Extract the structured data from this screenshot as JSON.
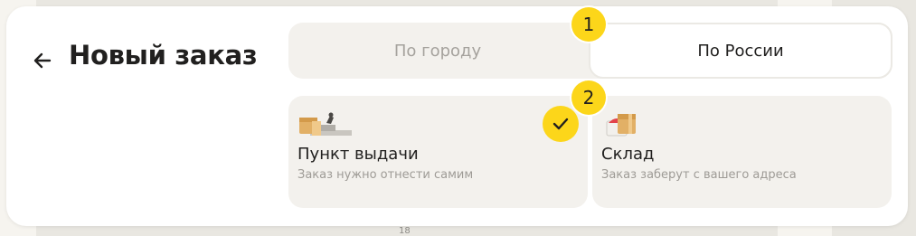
{
  "header": {
    "title": "Новый заказ"
  },
  "tabs": {
    "city_label": "По городу",
    "russia_label": "По России",
    "active": "По России"
  },
  "delivery_options": [
    {
      "title": "Пункт выдачи",
      "subtitle": "Заказ нужно отнести самим",
      "selected": true
    },
    {
      "title": "Склад",
      "subtitle": "Заказ заберут с вашего адреса",
      "selected": false
    }
  ],
  "annotations": {
    "badge_1": "1",
    "badge_2": "2"
  },
  "map": {
    "label_18": "18"
  },
  "colors": {
    "accent_yellow": "#fcd61a",
    "panel": "#ffffff",
    "surface": "#f3f1ed",
    "text_primary": "#21201f",
    "text_secondary": "#9e9b96",
    "map_background": "#e9e7e1"
  },
  "icons": {
    "back": "arrow-left-icon",
    "pickup": "pickup-point-box-icon",
    "warehouse": "warehouse-box-icon",
    "selected": "checkmark-icon"
  }
}
